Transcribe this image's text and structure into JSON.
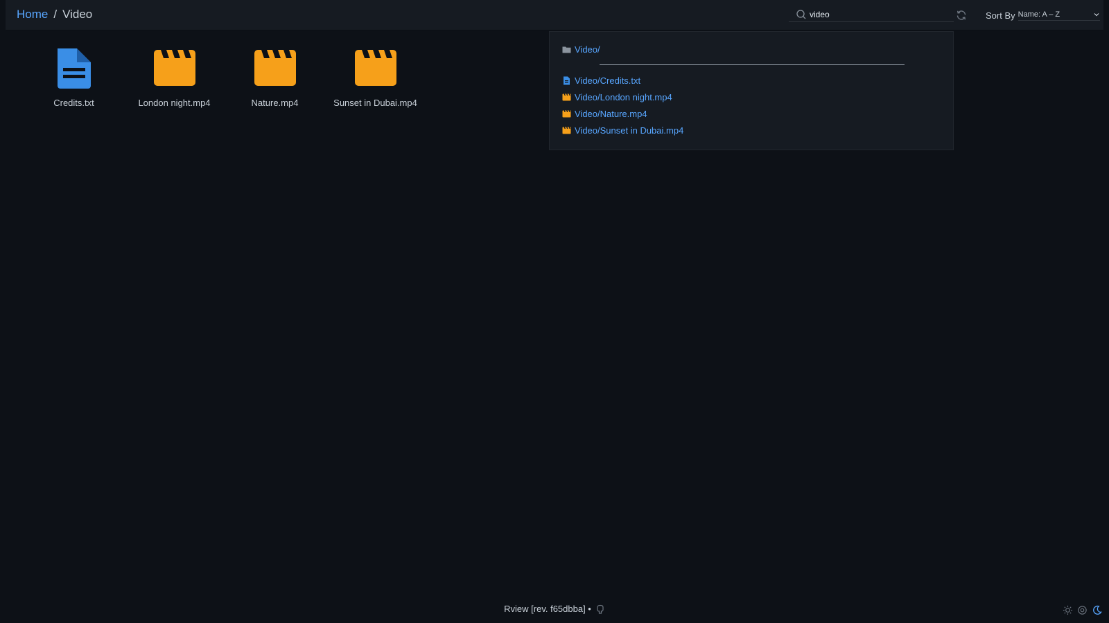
{
  "breadcrumb": {
    "home": "Home",
    "separator": "/",
    "current": "Video"
  },
  "search": {
    "value": "video",
    "icon": "search-icon"
  },
  "sort": {
    "label": "Sort By",
    "value": "Name: A – Z"
  },
  "files": [
    {
      "name": "Credits.txt",
      "icon": "document-icon",
      "color": "#3a8ee6"
    },
    {
      "name": "London night.mp4",
      "icon": "clapperboard-icon",
      "color": "#f6a01a"
    },
    {
      "name": "Nature.mp4",
      "icon": "clapperboard-icon",
      "color": "#f6a01a"
    },
    {
      "name": "Sunset in Dubai.mp4",
      "icon": "clapperboard-icon",
      "color": "#f6a01a"
    }
  ],
  "results": {
    "folder": "Video/",
    "items": [
      {
        "path": "Video/Credits.txt",
        "icon": "document-icon"
      },
      {
        "path": "Video/London night.mp4",
        "icon": "clapperboard-icon"
      },
      {
        "path": "Video/Nature.mp4",
        "icon": "clapperboard-icon"
      },
      {
        "path": "Video/Sunset in Dubai.mp4",
        "icon": "clapperboard-icon"
      }
    ]
  },
  "footer": {
    "text": "Rview [rev. f65dbba] •"
  },
  "colors": {
    "accent": "#58a6ff",
    "background": "#0d1117",
    "header": "#161b22",
    "video": "#f6a01a",
    "document": "#3a8ee6"
  }
}
